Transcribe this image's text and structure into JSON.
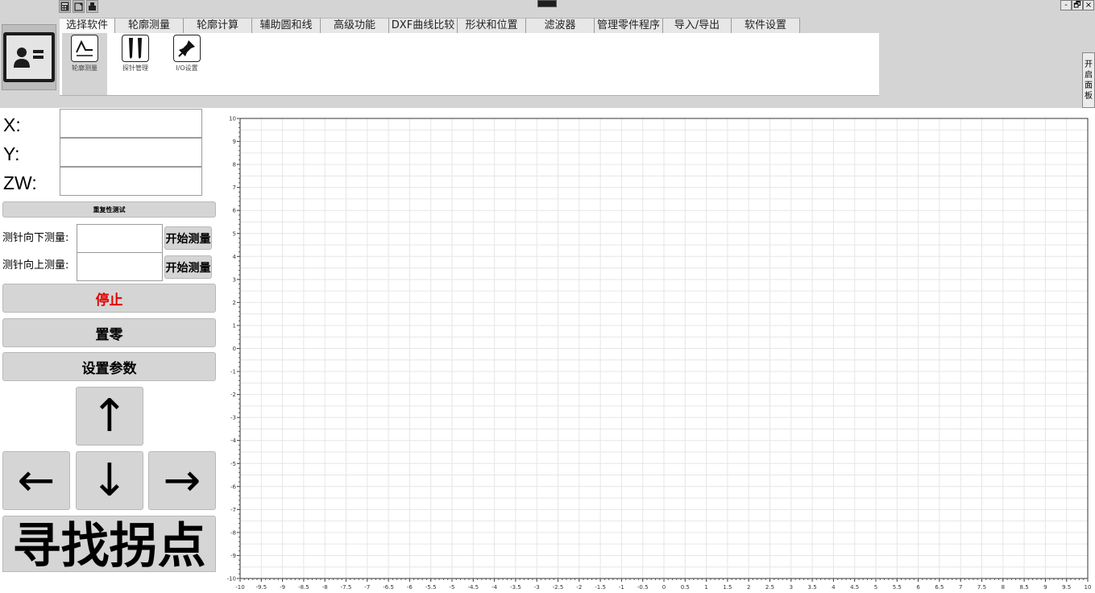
{
  "colors": {
    "accent_stop": "#e00000",
    "grid": "#e6e6e6",
    "ribbon_bg": "#d4d4d4"
  },
  "window": {
    "minimize": "-",
    "restore": "🗗",
    "close": "×"
  },
  "quick_access": [
    "calculator-icon",
    "window-icon",
    "tool-icon"
  ],
  "tabs": [
    {
      "label": "选择软件",
      "w": 69
    },
    {
      "label": "轮廓测量",
      "w": 85
    },
    {
      "label": "轮廓计算",
      "w": 85
    },
    {
      "label": "辅助圆和线",
      "w": 85
    },
    {
      "label": "高级功能",
      "w": 85
    },
    {
      "label": "DXF曲线比较",
      "w": 85
    },
    {
      "label": "形状和位置",
      "w": 85
    },
    {
      "label": "滤波器",
      "w": 85
    },
    {
      "label": "管理零件程序",
      "w": 85
    },
    {
      "label": "导入/导出",
      "w": 85
    },
    {
      "label": "软件设置",
      "w": 85
    }
  ],
  "ribbon_items": [
    {
      "label": "轮廓测量",
      "icon": "profile-measure-icon"
    },
    {
      "label": "探针管理",
      "icon": "probe-icon"
    },
    {
      "label": "I/O设置",
      "icon": "pin-icon"
    }
  ],
  "open_panel_label": "开启面板",
  "coords": {
    "x_label": "X:",
    "y_label": "Y:",
    "zw_label": "ZW:",
    "x_value": "",
    "y_value": "",
    "zw_value": ""
  },
  "controls": {
    "repeat_test": "重复性测试",
    "probe_down_label": "测针向下测量:",
    "probe_up_label": "测针向上测量:",
    "probe_down_value": "",
    "probe_up_value": "",
    "start_measure_1": "开始测量",
    "start_measure_2": "开始测量",
    "stop": "停止",
    "zero": "置零",
    "settings": "设置参数",
    "up": "↑",
    "down": "↓",
    "left": "←",
    "right": "→",
    "find_inflection": "寻找拐点"
  },
  "chart_data": {
    "type": "scatter",
    "title": "",
    "xlabel": "",
    "ylabel": "",
    "xlim": [
      -10,
      10
    ],
    "ylim": [
      -10,
      10
    ],
    "x_ticks": [
      -10,
      -9.5,
      -9,
      -8.5,
      -8,
      -7.5,
      -7,
      -6.5,
      -6,
      -5.5,
      -5,
      -4.5,
      -4,
      -3.5,
      -3,
      -2.5,
      -2,
      -1.5,
      -1,
      -0.5,
      0,
      0.5,
      1,
      1.5,
      2,
      2.5,
      3,
      3.5,
      4,
      4.5,
      5,
      5.5,
      6,
      6.5,
      7,
      7.5,
      8,
      8.5,
      9,
      9.5,
      10
    ],
    "y_ticks": [
      10,
      9,
      8,
      7,
      6,
      5,
      4,
      3,
      2,
      1,
      0,
      -1,
      -2,
      -3,
      -4,
      -5,
      -6,
      -7,
      -8,
      -9,
      -10
    ],
    "grid": true,
    "series": []
  }
}
